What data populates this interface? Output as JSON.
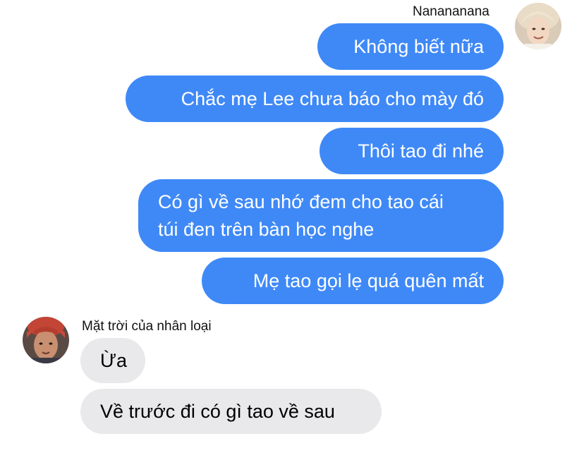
{
  "outgoing": {
    "sender_name": "Nanananana",
    "messages": [
      {
        "text": "Không biết nữa"
      },
      {
        "text": "Chắc mẹ Lee chưa báo cho mày đó"
      },
      {
        "text": "Thôi tao đi nhé"
      },
      {
        "lines": [
          "Có gì về sau nhớ đem cho tao cái",
          "túi đen trên bàn học nghe"
        ]
      },
      {
        "text": "Mẹ tao gọi lẹ quá quên mất"
      }
    ]
  },
  "incoming": {
    "sender_name": "Mặt trời của nhân loại",
    "messages": [
      {
        "text": "Ừa"
      },
      {
        "text": "Về trước đi có gì tao về sau"
      }
    ]
  },
  "colors": {
    "outgoing_bubble": "#3f89f7",
    "incoming_bubble": "#e9e9eb"
  }
}
